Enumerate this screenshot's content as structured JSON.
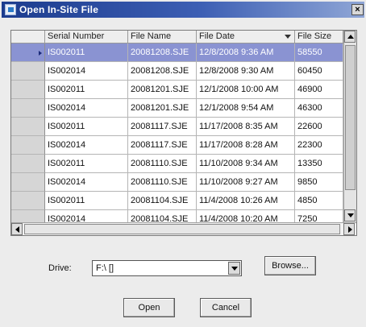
{
  "window": {
    "title": "Open In-Site File",
    "close_label": "×"
  },
  "table": {
    "columns": [
      "Serial Number",
      "File Name",
      "File Date",
      "File Size"
    ],
    "sorted_column": "File Date",
    "selected_row": 0,
    "rows": [
      [
        "IS002011",
        "20081208.SJE",
        "12/8/2008 9:36 AM",
        "58550"
      ],
      [
        "IS002014",
        "20081208.SJE",
        "12/8/2008 9:30 AM",
        "60450"
      ],
      [
        "IS002011",
        "20081201.SJE",
        "12/1/2008 10:00 AM",
        "46900"
      ],
      [
        "IS002014",
        "20081201.SJE",
        "12/1/2008 9:54 AM",
        "46300"
      ],
      [
        "IS002011",
        "20081117.SJE",
        "11/17/2008 8:35 AM",
        "22600"
      ],
      [
        "IS002014",
        "20081117.SJE",
        "11/17/2008 8:28 AM",
        "22300"
      ],
      [
        "IS002011",
        "20081110.SJE",
        "11/10/2008 9:34 AM",
        "13350"
      ],
      [
        "IS002014",
        "20081110.SJE",
        "11/10/2008 9:27 AM",
        "9850"
      ],
      [
        "IS002011",
        "20081104.SJE",
        "11/4/2008 10:26 AM",
        "4850"
      ],
      [
        "IS002014",
        "20081104.SJE",
        "11/4/2008 10:20 AM",
        "7250"
      ]
    ]
  },
  "drive": {
    "label": "Drive:",
    "value": "F:\\ []"
  },
  "buttons": {
    "browse": "Browse...",
    "open": "Open",
    "cancel": "Cancel"
  },
  "colors": {
    "title_bar": "#1c3c8e",
    "selection": "#8a93d2"
  },
  "icons": {
    "app": "open-file-icon",
    "sort": "sort-descending-icon"
  }
}
